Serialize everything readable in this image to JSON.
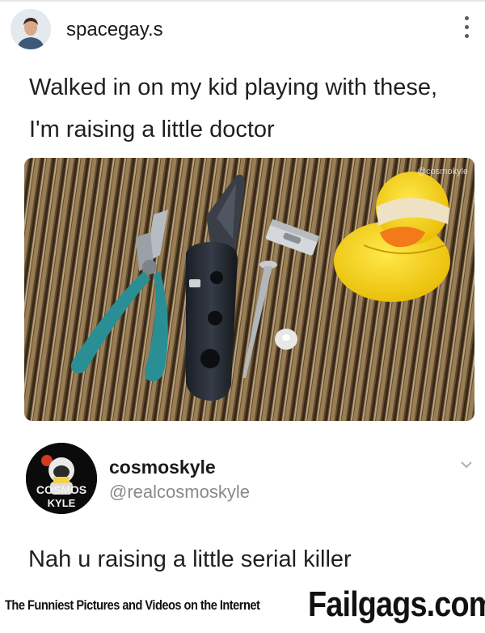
{
  "post": {
    "username": "spacegay.s",
    "caption": "Walked in on my kid playing with these, I'm raising a little doctor",
    "photo_watermark": "@cosmokyle"
  },
  "reply": {
    "display_name": "cosmoskyle",
    "handle": "@realcosmoskyle",
    "avatar_text_top": "COSMOS",
    "avatar_text_bottom": "KYLE",
    "text": "Nah u raising a little serial killer"
  },
  "footer": {
    "tagline": "The Funniest Pictures and Videos on the Internet",
    "brand": "Failgags.com"
  },
  "icons": {
    "menu": "more-vertical-icon",
    "reply_menu": "chevron-down-icon"
  }
}
